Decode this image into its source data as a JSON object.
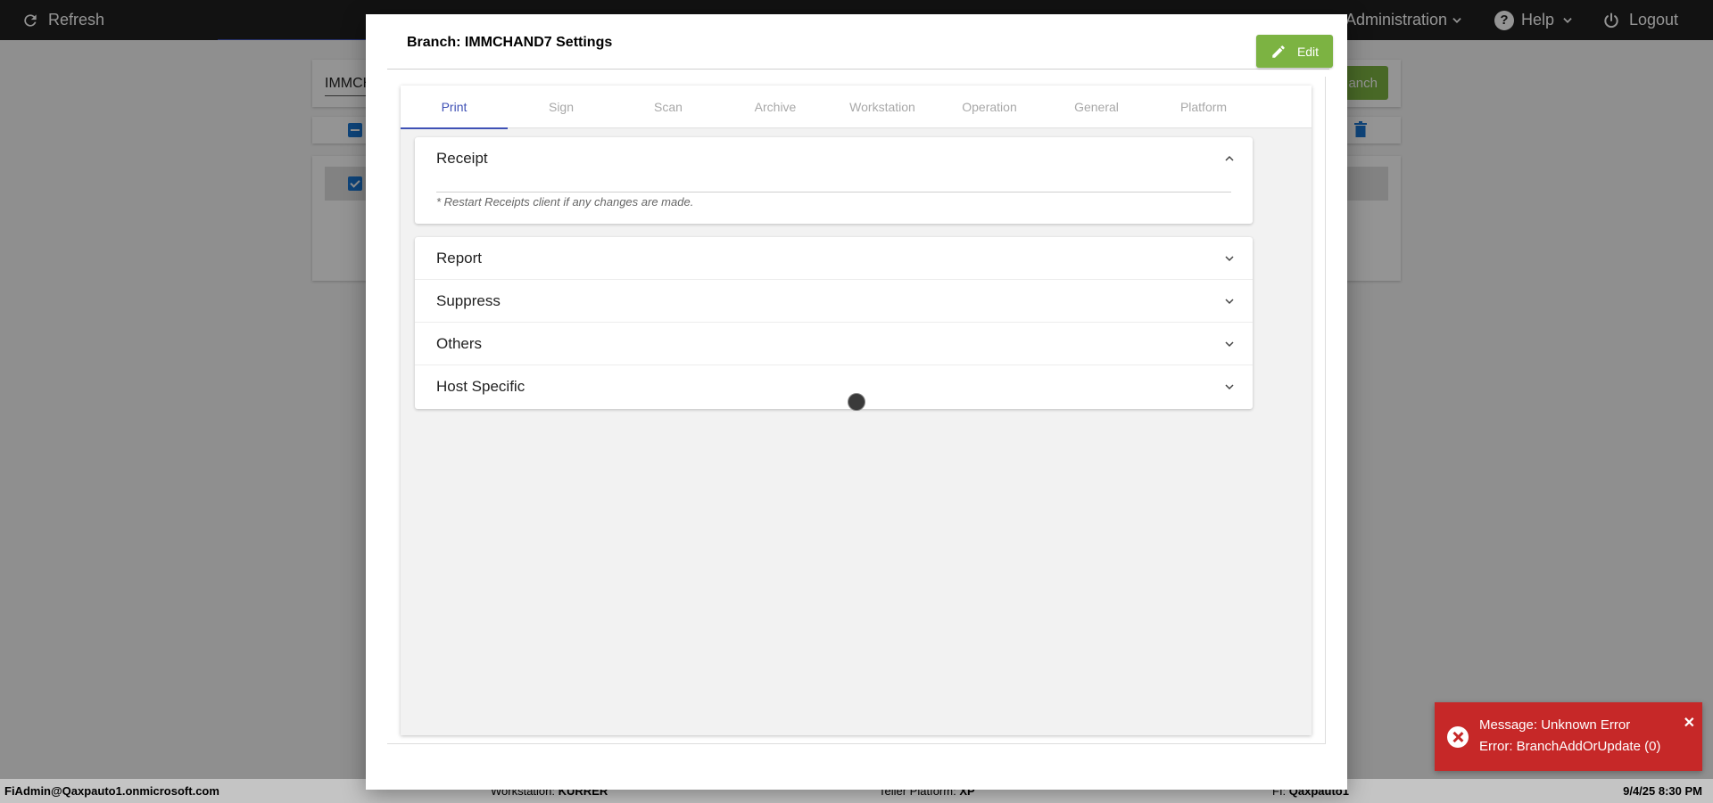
{
  "topbar": {
    "refresh_label": "Refresh",
    "administration_label": "Administration",
    "help_label": "Help",
    "logout_label": "Logout"
  },
  "background": {
    "search_text": "IMMCH",
    "primary_button_label": "anch"
  },
  "modal": {
    "title": "Branch: IMMCHAND7 Settings",
    "edit_label": "Edit",
    "tabs": [
      {
        "label": "Print",
        "active": true
      },
      {
        "label": "Sign",
        "active": false
      },
      {
        "label": "Scan",
        "active": false
      },
      {
        "label": "Archive",
        "active": false
      },
      {
        "label": "Workstation",
        "active": false
      },
      {
        "label": "Operation",
        "active": false
      },
      {
        "label": "General",
        "active": false
      },
      {
        "label": "Platform",
        "active": false
      }
    ],
    "receipt": {
      "title": "Receipt",
      "note": "* Restart Receipts client if any changes are made."
    },
    "sections": [
      {
        "label": "Report"
      },
      {
        "label": "Suppress"
      },
      {
        "label": "Others"
      },
      {
        "label": "Host Specific"
      }
    ]
  },
  "statusbar": {
    "user": "FiAdmin@Qaxpauto1.onmicrosoft.com",
    "workstation_label": "Workstation:",
    "workstation_value": "KURRER",
    "teller_platform_label": "Teller Platform:",
    "teller_platform_value": "XP",
    "fi_label": "FI:",
    "fi_value": "Qaxpauto1",
    "datetime": "9/4/25 8:30 PM"
  },
  "toast": {
    "line1": "Message: Unknown Error",
    "line2": "Error: BranchAddOrUpdate (0)"
  },
  "colors": {
    "topbar_bg": "#1f1f1f",
    "accent": "#3f51b5",
    "edit_button": "#7cb342",
    "toast_error": "#c62828"
  }
}
